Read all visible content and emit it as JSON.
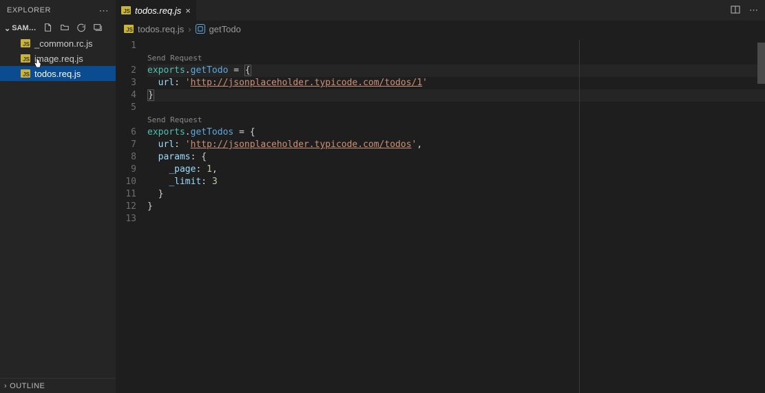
{
  "sidebar": {
    "title": "EXPLORER",
    "folder": "SAM…",
    "files": [
      {
        "icon": "JS",
        "name": "_common.rc.js"
      },
      {
        "icon": "JS",
        "name": "image.req.js"
      },
      {
        "icon": "JS",
        "name": "todos.req.js"
      }
    ],
    "outline": "OUTLINE"
  },
  "tab": {
    "icon": "JS",
    "label": "todos.req.js",
    "close": "×"
  },
  "breadcrumbs": {
    "file_icon": "JS",
    "file": "todos.req.js",
    "sep": "›",
    "symbol": "getTodo"
  },
  "codelens": {
    "sendRequest1": "Send Request",
    "sendRequest2": "Send Request"
  },
  "code": {
    "l2_exports": "exports",
    "l2_dot": ".",
    "l2_name": "getTodo",
    "l2_eq": " = ",
    "l2_brace": "{",
    "l3_url": "url",
    "l3_colon": ": ",
    "l3_q1": "'",
    "l3_urlval": "http://jsonplaceholder.typicode.com/todos/1",
    "l3_q2": "'",
    "l4_brace": "}",
    "l6_exports": "exports",
    "l6_dot": ".",
    "l6_name": "getTodos",
    "l6_eq": " = {",
    "l7_url": "url",
    "l7_colon": ": ",
    "l7_q1": "'",
    "l7_urlval": "http://jsonplaceholder.typicode.com/todos",
    "l7_q2": "'",
    "l7_comma": ",",
    "l8_params": "params",
    "l8_colon": ": {",
    "l9_page": "_page",
    "l9_colon": ": ",
    "l9_val": "1",
    "l9_comma": ",",
    "l10_limit": "_limit",
    "l10_colon": ": ",
    "l10_val": "3",
    "l11_brace": "}",
    "l12_brace": "}"
  },
  "lineNumbers": [
    "1",
    "2",
    "3",
    "4",
    "5",
    "",
    "6",
    "7",
    "8",
    "9",
    "10",
    "11",
    "12",
    "13"
  ]
}
